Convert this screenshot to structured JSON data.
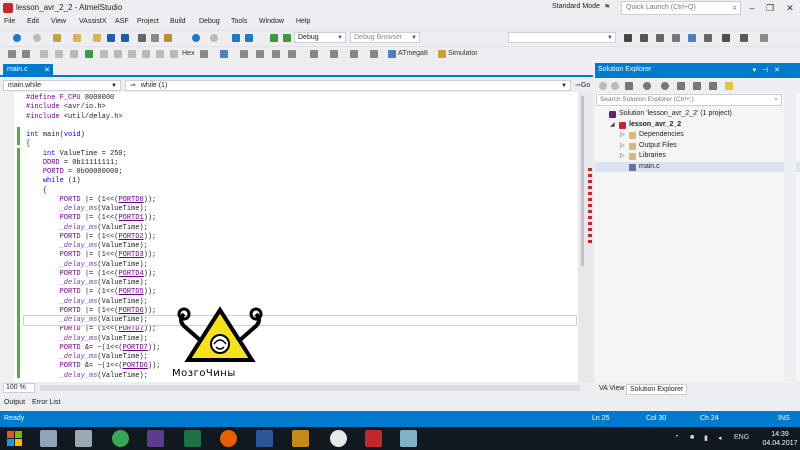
{
  "window": {
    "title": "lesson_avr_2_2 - AtmelStudio",
    "layout_label": "Standard Mode",
    "quick_launch_placeholder": "Quick Launch (Ctrl+Q)"
  },
  "menu": [
    "File",
    "Edit",
    "View",
    "VAssistX",
    "ASF",
    "Project",
    "Build",
    "Debug",
    "Tools",
    "Window",
    "Help"
  ],
  "toolbar": {
    "config": "Debug",
    "platform": "Debug Browser",
    "hex_label": "Hex",
    "device": "ATmega8",
    "tool": "Simulator"
  },
  "editor": {
    "tab_label": "main.c",
    "nav_scope": "main.while",
    "nav_member": "while (1)",
    "go_label": "Go",
    "zoom": "100 %",
    "code_lines": [
      [
        {
          "t": "#define ",
          "c": "macro"
        },
        {
          "t": "F_CPU",
          "c": "macro"
        },
        {
          "t": " 8000000",
          "c": ""
        }
      ],
      [
        {
          "t": "#include ",
          "c": "macro"
        },
        {
          "t": "<avr/io.h>",
          "c": ""
        }
      ],
      [
        {
          "t": "#include ",
          "c": "macro"
        },
        {
          "t": "<util/delay.h>",
          "c": ""
        }
      ],
      [],
      [
        {
          "t": "int ",
          "c": "kw"
        },
        {
          "t": "main",
          "c": ""
        },
        {
          "t": "(",
          "c": ""
        },
        {
          "t": "void",
          "c": "kw"
        },
        {
          "t": ")",
          "c": ""
        }
      ],
      [
        {
          "t": "{",
          "c": ""
        }
      ],
      [
        {
          "t": "    ",
          "c": ""
        },
        {
          "t": "int ",
          "c": "kw"
        },
        {
          "t": "ValueTime = 250;",
          "c": ""
        }
      ],
      [
        {
          "t": "    ",
          "c": ""
        },
        {
          "t": "DDRD",
          "c": "macro"
        },
        {
          "t": " = 0b11111111;",
          "c": ""
        }
      ],
      [
        {
          "t": "    ",
          "c": ""
        },
        {
          "t": "PORTD",
          "c": "macro"
        },
        {
          "t": " = 0b00000000;",
          "c": ""
        }
      ],
      [
        {
          "t": "    ",
          "c": ""
        },
        {
          "t": "while",
          "c": "kw"
        },
        {
          "t": " (1)",
          "c": ""
        }
      ],
      [
        {
          "t": "    {",
          "c": ""
        }
      ],
      [
        {
          "t": "        ",
          "c": ""
        },
        {
          "t": "PORTD",
          "c": "macro"
        },
        {
          "t": " |= (1<<(",
          "c": ""
        },
        {
          "t": "PORTD0",
          "c": "macro bit"
        },
        {
          "t": "));",
          "c": ""
        }
      ],
      [
        {
          "t": "        ",
          "c": ""
        },
        {
          "t": "_delay_ms",
          "c": "fn"
        },
        {
          "t": "(ValueTime);",
          "c": ""
        }
      ],
      [
        {
          "t": "        ",
          "c": ""
        },
        {
          "t": "PORTD",
          "c": "macro"
        },
        {
          "t": " |= (1<<(",
          "c": ""
        },
        {
          "t": "PORTD1",
          "c": "macro bit"
        },
        {
          "t": "));",
          "c": ""
        }
      ],
      [
        {
          "t": "        ",
          "c": ""
        },
        {
          "t": "_delay_ms",
          "c": "fn"
        },
        {
          "t": "(ValueTime);",
          "c": ""
        }
      ],
      [
        {
          "t": "        ",
          "c": ""
        },
        {
          "t": "PORTD",
          "c": "macro"
        },
        {
          "t": " |= (1<<(",
          "c": ""
        },
        {
          "t": "PORTD2",
          "c": "macro bit"
        },
        {
          "t": "));",
          "c": ""
        }
      ],
      [
        {
          "t": "        ",
          "c": ""
        },
        {
          "t": "_delay_ms",
          "c": "fn"
        },
        {
          "t": "(ValueTime);",
          "c": ""
        }
      ],
      [
        {
          "t": "        ",
          "c": ""
        },
        {
          "t": "PORTD",
          "c": "macro"
        },
        {
          "t": " |= (1<<(",
          "c": ""
        },
        {
          "t": "PORTD3",
          "c": "macro bit"
        },
        {
          "t": "));",
          "c": ""
        }
      ],
      [
        {
          "t": "        ",
          "c": ""
        },
        {
          "t": "_delay_ms",
          "c": "fn"
        },
        {
          "t": "(ValueTime);",
          "c": ""
        }
      ],
      [
        {
          "t": "        ",
          "c": ""
        },
        {
          "t": "PORTD",
          "c": "macro"
        },
        {
          "t": " |= (1<<(",
          "c": ""
        },
        {
          "t": "PORTD4",
          "c": "macro bit"
        },
        {
          "t": "));",
          "c": ""
        }
      ],
      [
        {
          "t": "        ",
          "c": ""
        },
        {
          "t": "_delay_ms",
          "c": "fn"
        },
        {
          "t": "(ValueTime);",
          "c": ""
        }
      ],
      [
        {
          "t": "        ",
          "c": ""
        },
        {
          "t": "PORTD",
          "c": "macro"
        },
        {
          "t": " |= (1<<(",
          "c": ""
        },
        {
          "t": "PORTD5",
          "c": "macro bit"
        },
        {
          "t": "));",
          "c": ""
        }
      ],
      [
        {
          "t": "        ",
          "c": ""
        },
        {
          "t": "_delay_ms",
          "c": "fn"
        },
        {
          "t": "(ValueTime);",
          "c": ""
        }
      ],
      [
        {
          "t": "        ",
          "c": ""
        },
        {
          "t": "PORTD",
          "c": "macro"
        },
        {
          "t": " |= (1<<(",
          "c": ""
        },
        {
          "t": "PORTD6",
          "c": "macro bit"
        },
        {
          "t": "));",
          "c": ""
        }
      ],
      [
        {
          "t": "        ",
          "c": ""
        },
        {
          "t": "_delay_ms",
          "c": "fn"
        },
        {
          "t": "(ValueTime);",
          "c": ""
        }
      ],
      [
        {
          "t": "        ",
          "c": ""
        },
        {
          "t": "PORTD",
          "c": "macro"
        },
        {
          "t": " |= (1<<(",
          "c": ""
        },
        {
          "t": "PORTD7",
          "c": "macro bit"
        },
        {
          "t": "));",
          "c": ""
        }
      ],
      [
        {
          "t": "        ",
          "c": ""
        },
        {
          "t": "_delay_ms",
          "c": "fn"
        },
        {
          "t": "(ValueTime);",
          "c": ""
        }
      ],
      [
        {
          "t": "        ",
          "c": ""
        },
        {
          "t": "PORTD",
          "c": "macro"
        },
        {
          "t": " &= ~(1<<(",
          "c": ""
        },
        {
          "t": "PORTD7",
          "c": "macro bit"
        },
        {
          "t": "));",
          "c": ""
        }
      ],
      [
        {
          "t": "        ",
          "c": ""
        },
        {
          "t": "_delay_ms",
          "c": "fn"
        },
        {
          "t": "(ValueTime);",
          "c": ""
        }
      ],
      [
        {
          "t": "        ",
          "c": ""
        },
        {
          "t": "PORTD",
          "c": "macro"
        },
        {
          "t": " &= ~(1<<(",
          "c": ""
        },
        {
          "t": "PORTD6",
          "c": "macro bit"
        },
        {
          "t": "));",
          "c": ""
        }
      ],
      [
        {
          "t": "        ",
          "c": ""
        },
        {
          "t": "_delay_ms",
          "c": "fn"
        },
        {
          "t": "(ValueTime);",
          "c": ""
        }
      ]
    ],
    "cursor_line": 24
  },
  "solution_explorer": {
    "title": "Solution Explorer",
    "search_placeholder": "Search Solution Explorer (Ctrl+;)",
    "tree": [
      {
        "label": "Solution 'lesson_avr_2_2' (1 project)",
        "level": 0,
        "expander": "",
        "icon": "solution-icon",
        "color": "#68217a"
      },
      {
        "label": "lesson_avr_2_2",
        "level": 1,
        "expander": "◢",
        "icon": "project-icon",
        "color": "#c1272d",
        "bold": true
      },
      {
        "label": "Dependencies",
        "level": 2,
        "expander": "▷",
        "icon": "folder-icon",
        "color": "#dcb67a"
      },
      {
        "label": "Output Files",
        "level": 2,
        "expander": "▷",
        "icon": "folder-icon",
        "color": "#dcb67a"
      },
      {
        "label": "Libraries",
        "level": 2,
        "expander": "▷",
        "icon": "folder-icon",
        "color": "#dcb67a"
      },
      {
        "label": "main.c",
        "level": 2,
        "expander": "",
        "icon": "c-file-icon",
        "color": "#6f6f9f",
        "selected": true
      }
    ],
    "bottom_tabs": [
      "VA View",
      "Solution Explorer"
    ]
  },
  "output_tabs": [
    "Output",
    "Error List"
  ],
  "status": {
    "state": "Ready",
    "line": "Ln 25",
    "col": "Col 30",
    "ch": "Ch 24",
    "mode": "INS"
  },
  "taskbar": {
    "lang": "ENG",
    "time": "14:39",
    "date": "04.04.2017"
  },
  "watermark": {
    "text": "МозгоЧины"
  },
  "colors": {
    "accent": "#007acc",
    "keyword": "#0000ff",
    "macro": "#6f008a",
    "change_green": "#57a64a"
  }
}
